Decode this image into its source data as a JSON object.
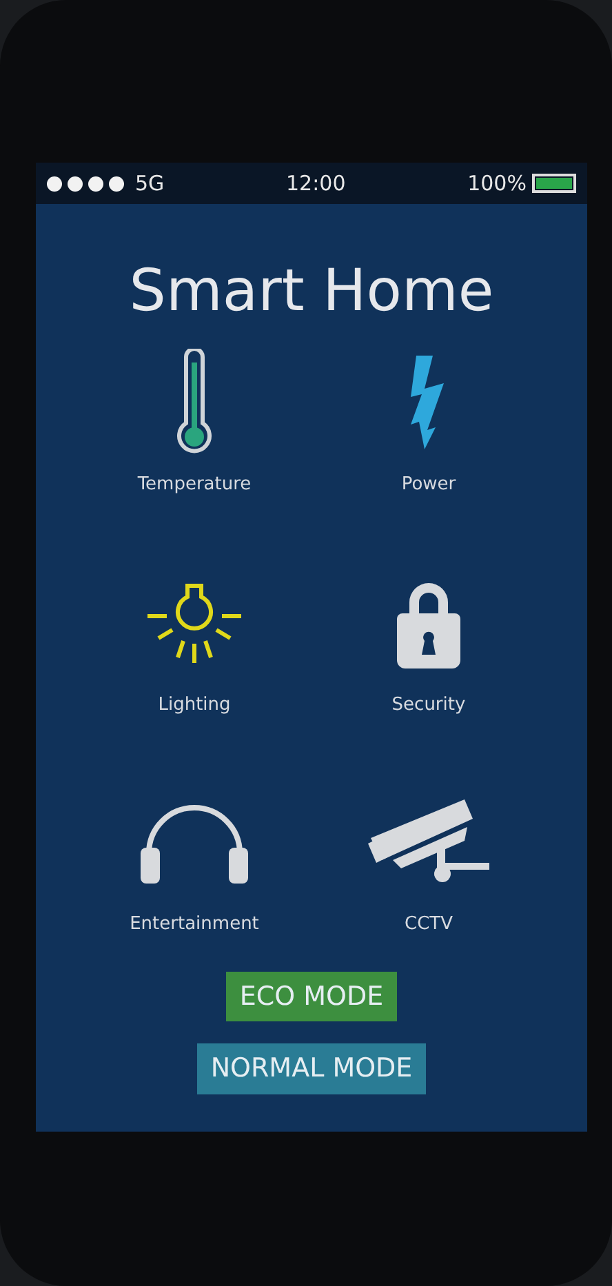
{
  "status_bar": {
    "network": "5G",
    "time": "12:00",
    "battery": "100%"
  },
  "title": "Smart Home",
  "tiles": [
    {
      "kind": "thermometer",
      "label": "Temperature"
    },
    {
      "kind": "bolt",
      "label": "Power"
    },
    {
      "kind": "bulb",
      "label": "Lighting"
    },
    {
      "kind": "lock",
      "label": "Security"
    },
    {
      "kind": "headphones",
      "label": "Entertainment"
    },
    {
      "kind": "camera",
      "label": "CCTV"
    }
  ],
  "buttons": [
    {
      "label": "ECO MODE",
      "color": "#3d8f3f"
    },
    {
      "label": "NORMAL MODE",
      "color": "#2a7c95"
    }
  ]
}
